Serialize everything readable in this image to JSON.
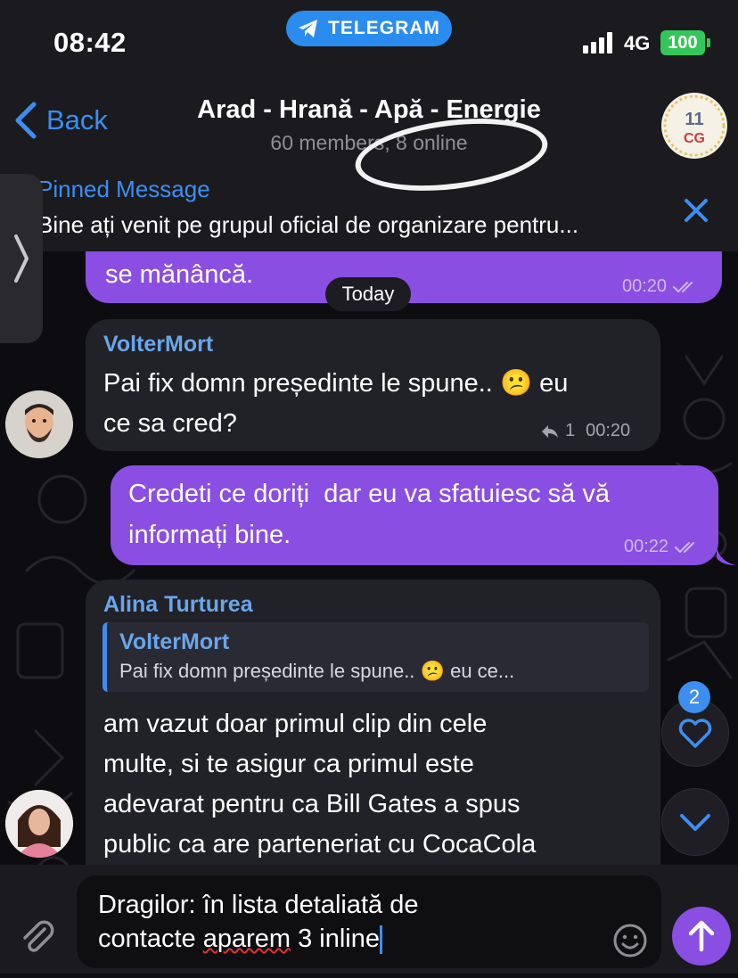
{
  "status_bar": {
    "time": "08:42",
    "app_pill": "TELEGRAM",
    "network": "4G",
    "battery": "100"
  },
  "header": {
    "back_label": "Back",
    "title": "Arad - Hrană - Apă - Energie",
    "subtitle": "60 members, 8 online",
    "avatar_text": "11",
    "avatar_sub": "CG"
  },
  "pinned": {
    "title": "Pinned Message",
    "text": "Bine ați venit pe grupul oficial de organizare pentru..."
  },
  "date_separator": "Today",
  "messages": [
    {
      "type": "outgoing",
      "text": "se mănâncă.",
      "time": "00:20"
    },
    {
      "type": "incoming",
      "sender": "VolterMort",
      "text_line1": "Pai fix domn președinte le spune..",
      "emoji": "😕",
      "text_after_emoji": "eu",
      "text_line2": "ce sa cred?",
      "replies": "1",
      "time": "00:20"
    },
    {
      "type": "outgoing",
      "text_line1": "Credeti ce doriți  dar eu va sfatuiesc să vă",
      "text_line2": "informați bine.",
      "time": "00:22"
    },
    {
      "type": "incoming",
      "sender": "Alina Turturea",
      "quote_sender": "VolterMort",
      "quote_text": "Pai fix domn președinte le spune..",
      "quote_emoji": "😕",
      "quote_tail": "eu ce...",
      "lines": [
        "am vazut doar primul clip din cele",
        "multe, si te asigur ca primul este",
        "adevarat pentru ca Bill Gates a spus",
        "public ca are parteneriat cu CocaCola"
      ]
    }
  ],
  "reactions_badge": "2",
  "composer": {
    "line1": "Dragilor: în lista detaliată de",
    "line2_before": "contacte ",
    "line2_misspelled": "aparem",
    "line2_after": " 3 inline"
  },
  "colors": {
    "accent_blue": "#3d8ef0",
    "outgoing_bubble": "#8a4ee2",
    "incoming_bubble": "#212128",
    "battery_green": "#33c759"
  }
}
